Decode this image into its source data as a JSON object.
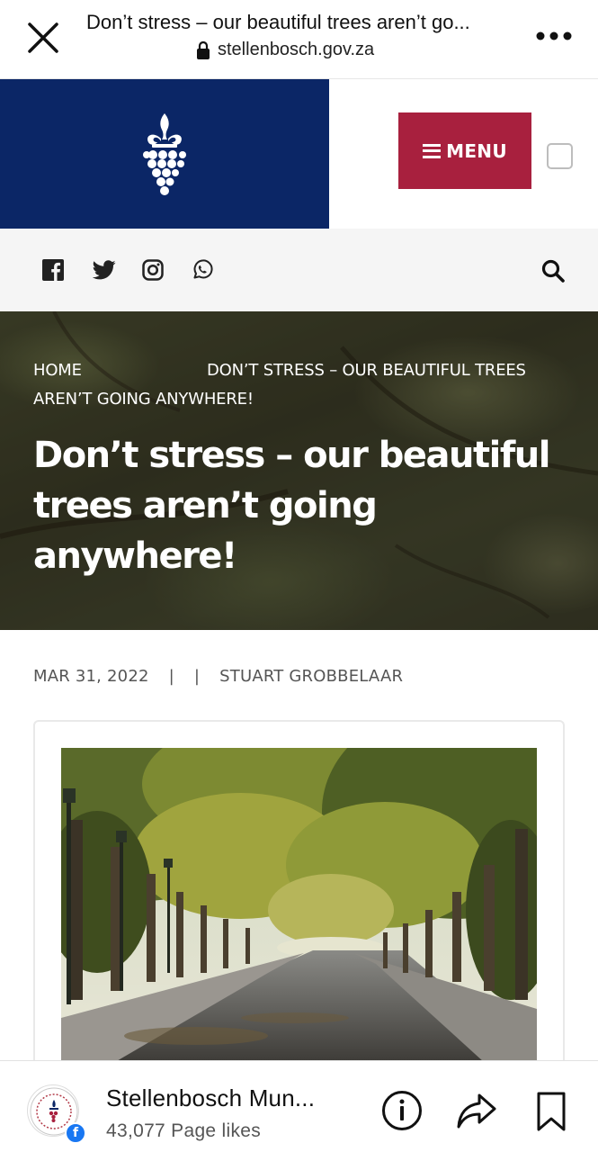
{
  "browser": {
    "title": "Don’t stress – our beautiful trees aren’t go...",
    "url": "stellenbosch.gov.za",
    "icons": [
      "close-icon",
      "lock-icon",
      "more-icon"
    ]
  },
  "header": {
    "menu_label": "MENU",
    "colors": {
      "logo_bg": "#0b2666",
      "menu_bg": "#a8203e"
    }
  },
  "social": {
    "icons": [
      "facebook-icon",
      "twitter-icon",
      "instagram-icon",
      "whatsapp-icon",
      "search-icon"
    ]
  },
  "hero": {
    "breadcrumb_home": "HOME",
    "breadcrumb_current": "DON’T STRESS – OUR BEAUTIFUL TREES AREN’T GOING ANYWHERE!",
    "title": "Don’t stress – our beautiful trees aren’t going anywhere!"
  },
  "meta": {
    "date": "MAR 31, 2022",
    "separator": "|",
    "author": "STUART GROBBELAAR"
  },
  "fb_page": {
    "name": "Stellenbosch Mun...",
    "likes": "43,077 Page likes",
    "badge": "f",
    "actions": [
      "info-icon",
      "share-icon",
      "bookmark-icon"
    ]
  }
}
